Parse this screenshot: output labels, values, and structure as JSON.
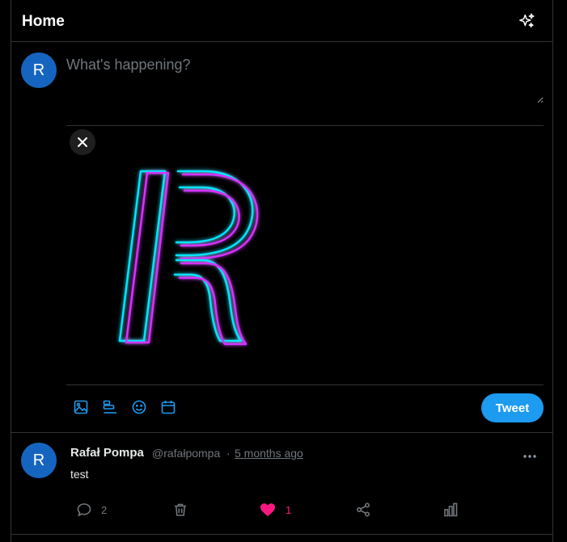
{
  "header": {
    "title": "Home",
    "icon": "sparkle-icon"
  },
  "composer": {
    "avatar_letter": "R",
    "placeholder": "What's happening?",
    "tools": [
      "image-icon",
      "poll-icon",
      "emoji-icon",
      "schedule-icon"
    ],
    "tweet_label": "Tweet"
  },
  "post": {
    "avatar_letter": "R",
    "name": "Rafał Pompa",
    "handle": "@rafałpompa",
    "separator": "·",
    "time": "5 months ago",
    "text": "test",
    "comments": "2",
    "likes": "1"
  },
  "colors": {
    "accent": "#1d9bf0",
    "like": "#f91880",
    "avatar": "#1565c0",
    "border": "#2f3336",
    "muted": "#71767b"
  }
}
